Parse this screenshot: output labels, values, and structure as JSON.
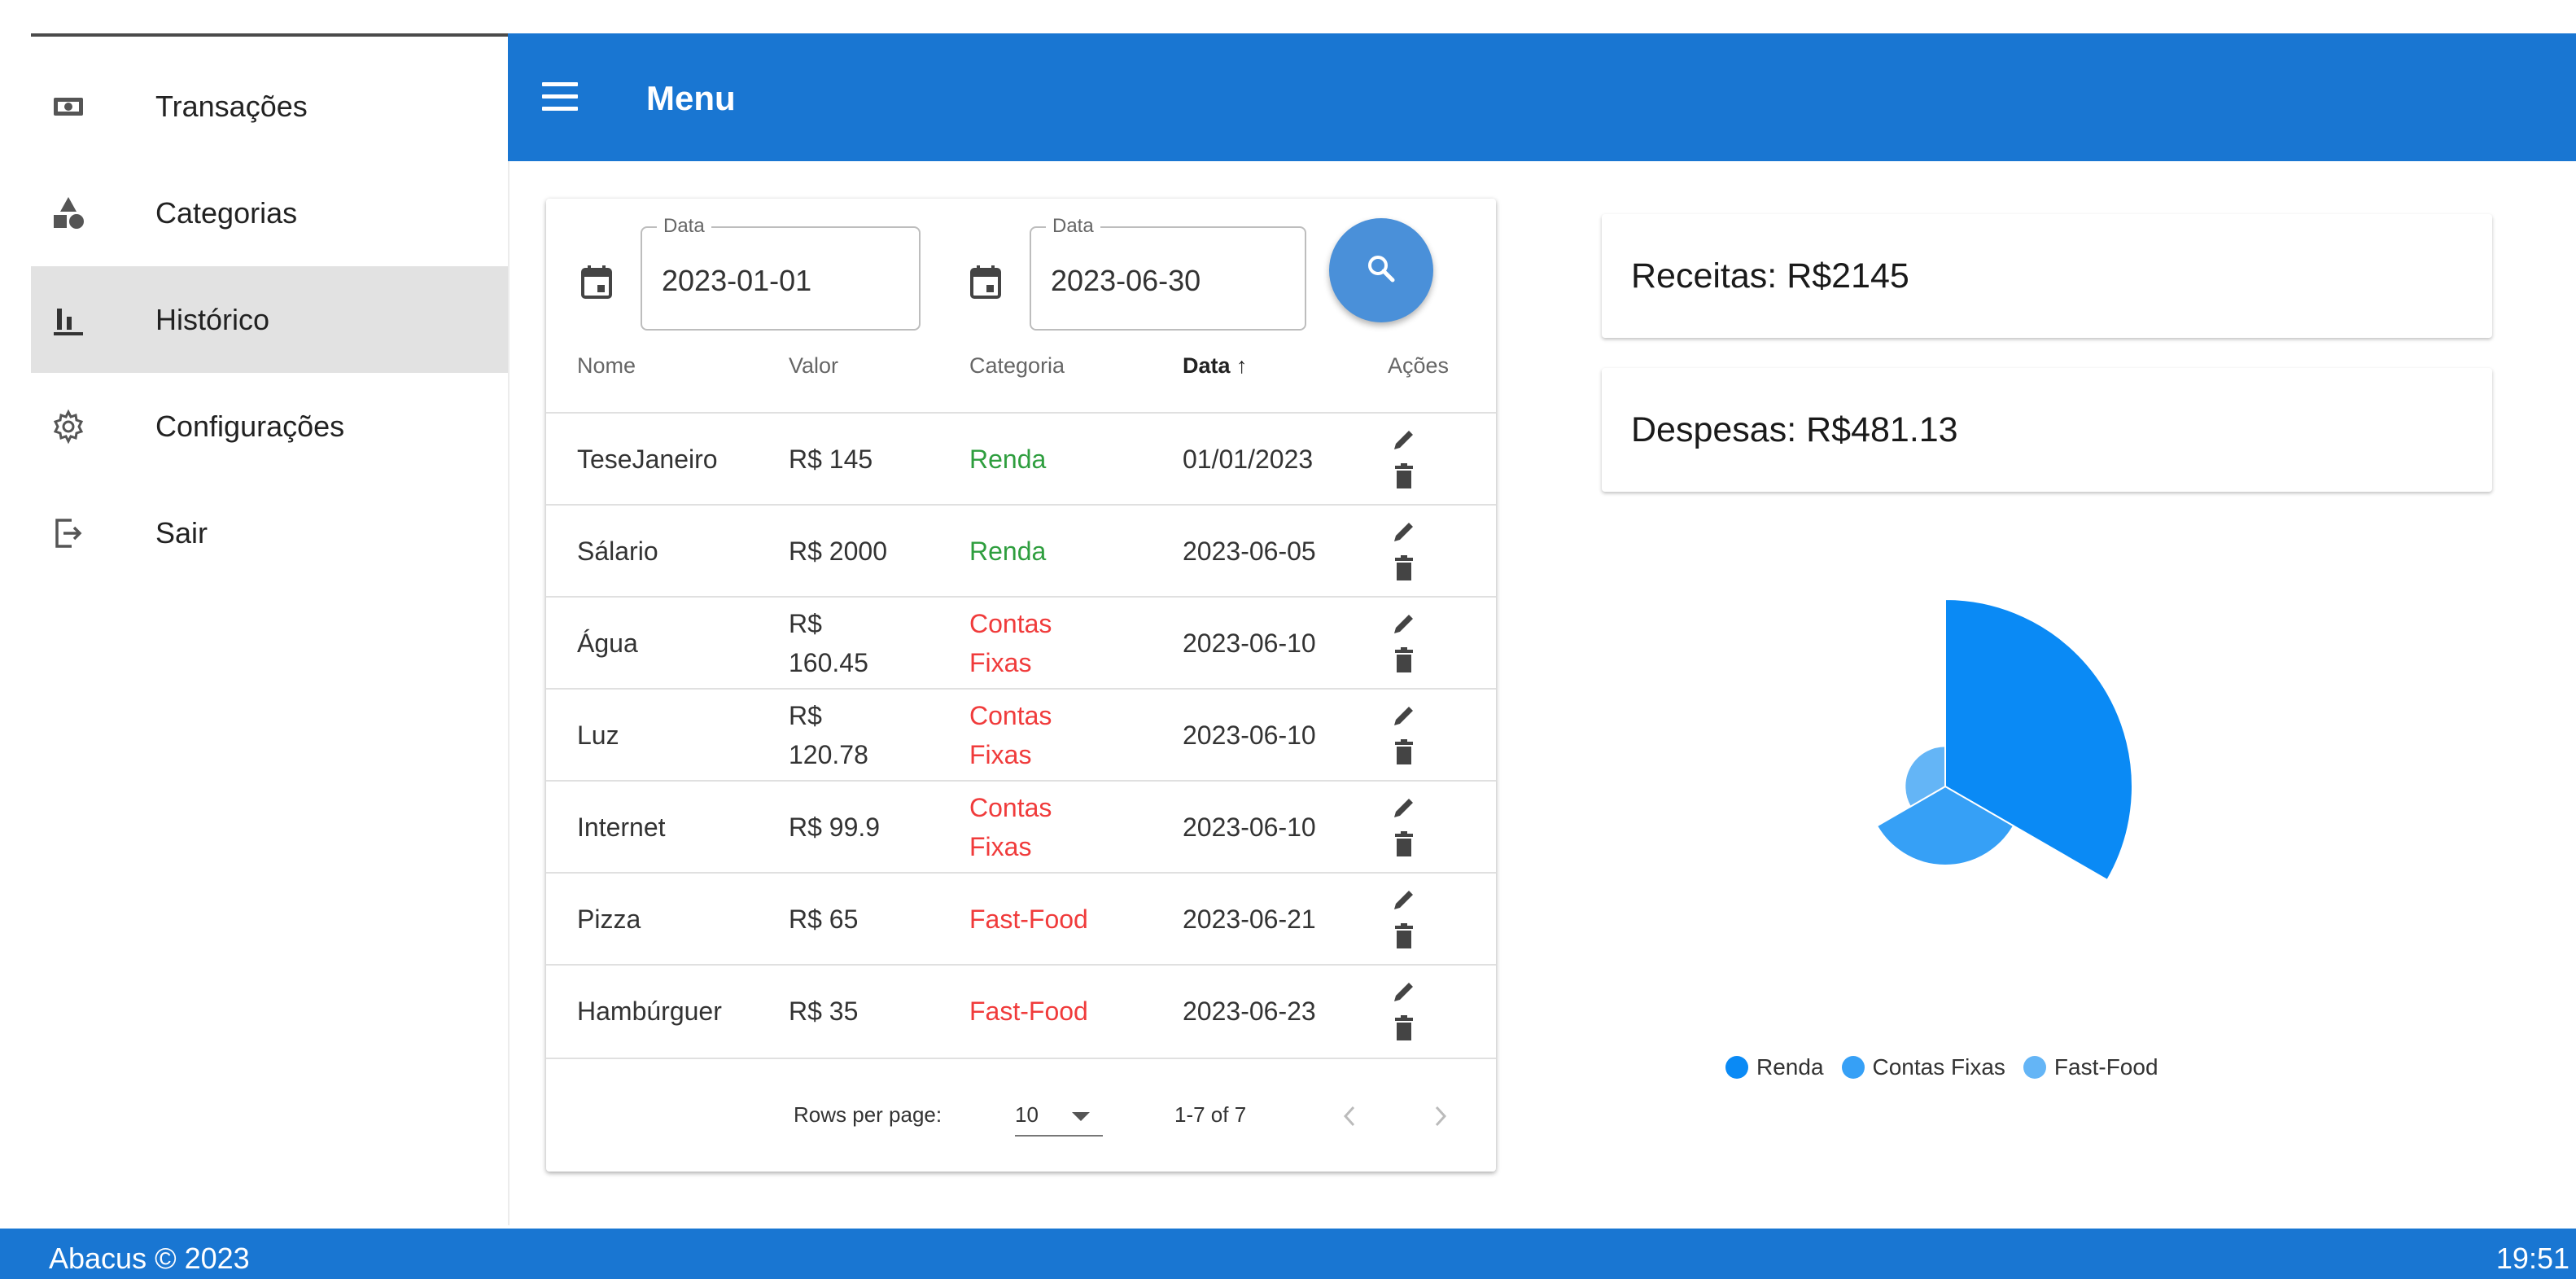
{
  "sidebar": {
    "items": [
      {
        "label": "Transações",
        "icon": "cash-icon"
      },
      {
        "label": "Categorias",
        "icon": "shapes-icon"
      },
      {
        "label": "Histórico",
        "icon": "bar-chart-icon"
      },
      {
        "label": "Configurações",
        "icon": "gear-icon"
      },
      {
        "label": "Sair",
        "icon": "logout-icon"
      }
    ],
    "active_index": 2
  },
  "appbar": {
    "title": "Menu"
  },
  "filters": {
    "start": {
      "label": "Data",
      "value": "2023-01-01"
    },
    "end": {
      "label": "Data",
      "value": "2023-06-30"
    }
  },
  "table": {
    "headers": {
      "nome": "Nome",
      "valor": "Valor",
      "categoria": "Categoria",
      "data": "Data",
      "data_sort": "↑",
      "acoes": "Ações"
    },
    "rows": [
      {
        "nome": "TeseJaneiro",
        "valor": [
          "R$ 145"
        ],
        "categoria": [
          "Renda"
        ],
        "type": "income",
        "data": "01/01/2023"
      },
      {
        "nome": "Sálario",
        "valor": [
          "R$ 2000"
        ],
        "categoria": [
          "Renda"
        ],
        "type": "income",
        "data": "2023-06-05"
      },
      {
        "nome": "Água",
        "valor": [
          "R$",
          "160.45"
        ],
        "categoria": [
          "Contas",
          "Fixas"
        ],
        "type": "expense",
        "data": "2023-06-10"
      },
      {
        "nome": "Luz",
        "valor": [
          "R$",
          "120.78"
        ],
        "categoria": [
          "Contas",
          "Fixas"
        ],
        "type": "expense",
        "data": "2023-06-10"
      },
      {
        "nome": "Internet",
        "valor": [
          "R$ 99.9"
        ],
        "categoria": [
          "Contas",
          "Fixas"
        ],
        "type": "expense",
        "data": "2023-06-10"
      },
      {
        "nome": "Pizza",
        "valor": [
          "R$ 65"
        ],
        "categoria": [
          "Fast-Food"
        ],
        "type": "expense",
        "data": "2023-06-21"
      },
      {
        "nome": "Hambúrguer",
        "valor": [
          "R$ 35"
        ],
        "categoria": [
          "Fast-Food"
        ],
        "type": "expense",
        "data": "2023-06-23"
      }
    ],
    "pagination": {
      "rows_per_page_label": "Rows per page:",
      "rows_per_page": "10",
      "range": "1-7 of 7"
    }
  },
  "summary": {
    "receitas": "Receitas: R$2145",
    "despesas": "Despesas: R$481.13",
    "colors": {
      "receitas": "#4caf50",
      "despesas": "#f44336"
    }
  },
  "chart_data": {
    "type": "pie",
    "variant": "polar-area",
    "categories": [
      "Renda",
      "Contas Fixas",
      "Fast-Food"
    ],
    "values": [
      2145,
      381.13,
      100
    ],
    "colors": [
      "#0a8af5",
      "#36a0f6",
      "#64b5f6"
    ],
    "legend_position": "bottom"
  },
  "footer": {
    "left": "Abacus © 2023",
    "right": "19:51"
  }
}
